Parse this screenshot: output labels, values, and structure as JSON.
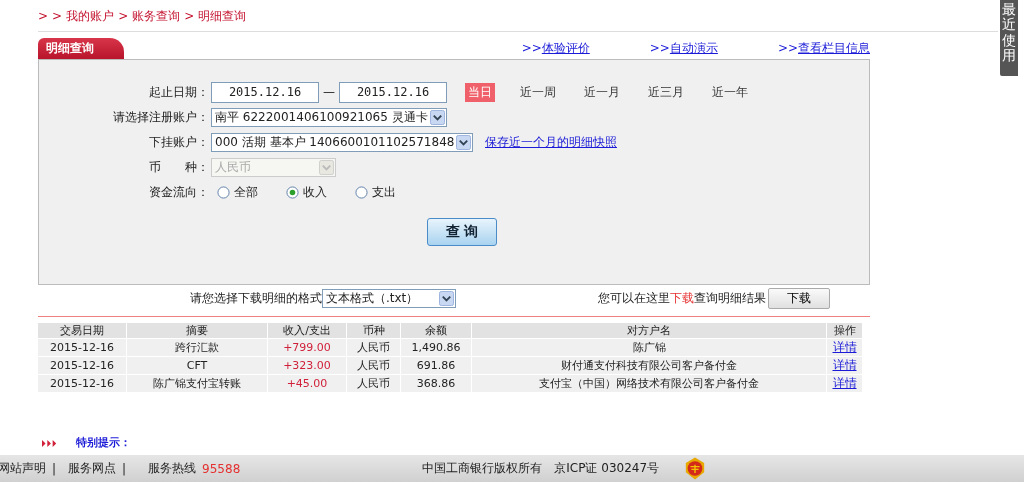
{
  "breadcrumb": {
    "marks": [
      ">",
      ">"
    ],
    "items": [
      "我的账户",
      "账务查询",
      "明细查询"
    ],
    "separator": ">"
  },
  "side_tab": {
    "label": "最近使用"
  },
  "panel": {
    "title": "明细查询",
    "links": [
      {
        "arrow": ">>",
        "label": "体验评价"
      },
      {
        "arrow": ">>",
        "label": "自动演示"
      },
      {
        "arrow": ">>",
        "label": "查看栏目信息"
      }
    ]
  },
  "form": {
    "date": {
      "label": "起止日期：",
      "from": "2015.12.16",
      "dash": "—",
      "to": "2015.12.16"
    },
    "periods": [
      {
        "label": "当日",
        "selected": true
      },
      {
        "label": "近一周",
        "selected": false
      },
      {
        "label": "近一月",
        "selected": false
      },
      {
        "label": "近三月",
        "selected": false
      },
      {
        "label": "近一年",
        "selected": false
      }
    ],
    "account": {
      "label": "请选择注册账户：",
      "value": "南平  6222001406100921065 灵通卡"
    },
    "sub_account": {
      "label": "下挂账户：",
      "value": "000 活期 基本户 1406600101102571848",
      "link": "保存近一个月的明细快照"
    },
    "currency": {
      "label": "币　　种：",
      "value": "人民币",
      "disabled": true
    },
    "direction": {
      "label": "资金流向：",
      "options": [
        {
          "label": "全部",
          "selected": false
        },
        {
          "label": "收入",
          "selected": true
        },
        {
          "label": "支出",
          "selected": false
        }
      ]
    },
    "query_button": "查 询"
  },
  "download": {
    "format_label": "请您选择下载明细的格式",
    "format_value": "文本格式（.txt）",
    "hint_before": "您可以在这里",
    "hint_link": "下载",
    "hint_after": "查询明细结果",
    "button": "下载"
  },
  "table": {
    "columns": [
      "交易日期",
      "摘要",
      "收入/支出",
      "币种",
      "余额",
      "对方户名",
      "操作"
    ],
    "rows": [
      {
        "date": "2015-12-16",
        "summary": "跨行汇款",
        "amount": "+799.00",
        "currency": "人民币",
        "balance": "1,490.86",
        "counterparty": "陈广锦",
        "action": "详情"
      },
      {
        "date": "2015-12-16",
        "summary": "CFT",
        "amount": "+323.00",
        "currency": "人民币",
        "balance": "691.86",
        "counterparty": "财付通支付科技有限公司客户备付金",
        "action": "详情"
      },
      {
        "date": "2015-12-16",
        "summary": "陈广锦支付宝转账",
        "amount": "+45.00",
        "currency": "人民币",
        "balance": "368.86",
        "counterparty": "支付宝（中国）网络技术有限公司客户备付金",
        "action": "详情"
      }
    ]
  },
  "notice": {
    "title": "特别提示："
  },
  "footer": {
    "left": [
      {
        "label": "网站声明"
      },
      {
        "label": "服务网点"
      }
    ],
    "separator": "|",
    "hotline_label": "服务热线",
    "hotline": "95588",
    "copyright": "中国工商银行版权所有",
    "icp": "京ICP证 030247号"
  }
}
